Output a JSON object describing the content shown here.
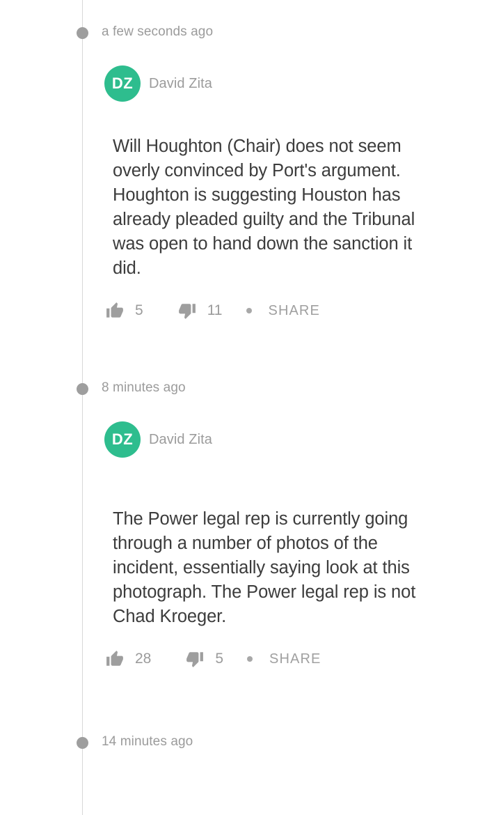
{
  "theme": {
    "background": "#ffffff",
    "rail_color": "#d8d8d8",
    "dot_color": "#9e9e9e",
    "avatar_color": "#2ebd8e",
    "body_text_color": "#3c3c3c",
    "muted_text_color": "#9b9b9b"
  },
  "labels": {
    "share": "SHARE",
    "thumb_up_icon": "thumb-up-icon",
    "thumb_down_icon": "thumb-down-icon",
    "separator_dot": "separator-dot"
  },
  "entries": [
    {
      "timestamp": "a few seconds ago",
      "author": {
        "initials": "DZ",
        "name": "David Zita"
      },
      "body": "Will Houghton (Chair) does not seem overly convinced by Port's argument. Houghton is suggesting Houston has already pleaded guilty and the Tribunal was open to hand down the sanction it did.",
      "likes": "5",
      "dislikes": "11",
      "share_label": "SHARE"
    },
    {
      "timestamp": "8 minutes ago",
      "author": {
        "initials": "DZ",
        "name": "David Zita"
      },
      "body": "The Power legal rep is currently going through a number of photos of the incident, essentially saying look at this photograph. The Power legal rep is not Chad Kroeger.",
      "likes": "28",
      "dislikes": "5",
      "share_label": "SHARE"
    },
    {
      "timestamp": "14 minutes ago"
    }
  ]
}
